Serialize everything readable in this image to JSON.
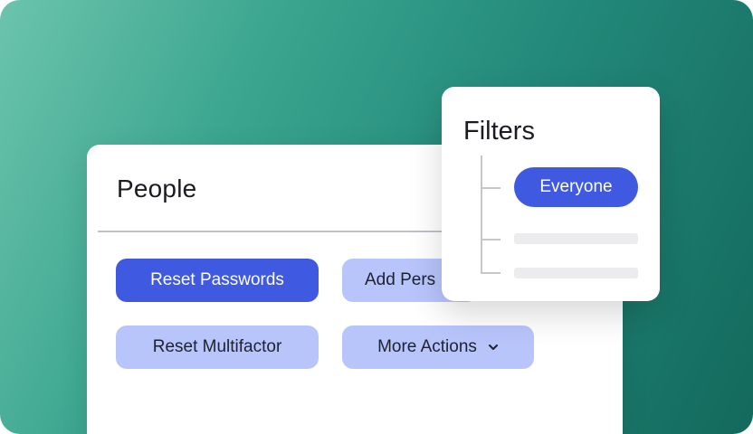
{
  "people_card": {
    "title": "People",
    "actions": {
      "reset_passwords": "Reset Passwords",
      "add_person": "Add Pers",
      "reset_multifactor": "Reset Multifactor",
      "more_actions": "More Actions"
    }
  },
  "filters_card": {
    "title": "Filters",
    "selected_filter": "Everyone"
  },
  "icons": {
    "more_actions_chevron": "chevron-down-icon"
  },
  "colors": {
    "primary": "#3f5ae0",
    "secondary": "#b8c5fb",
    "background_start": "#6cc4ad",
    "background_end": "#13695c"
  }
}
